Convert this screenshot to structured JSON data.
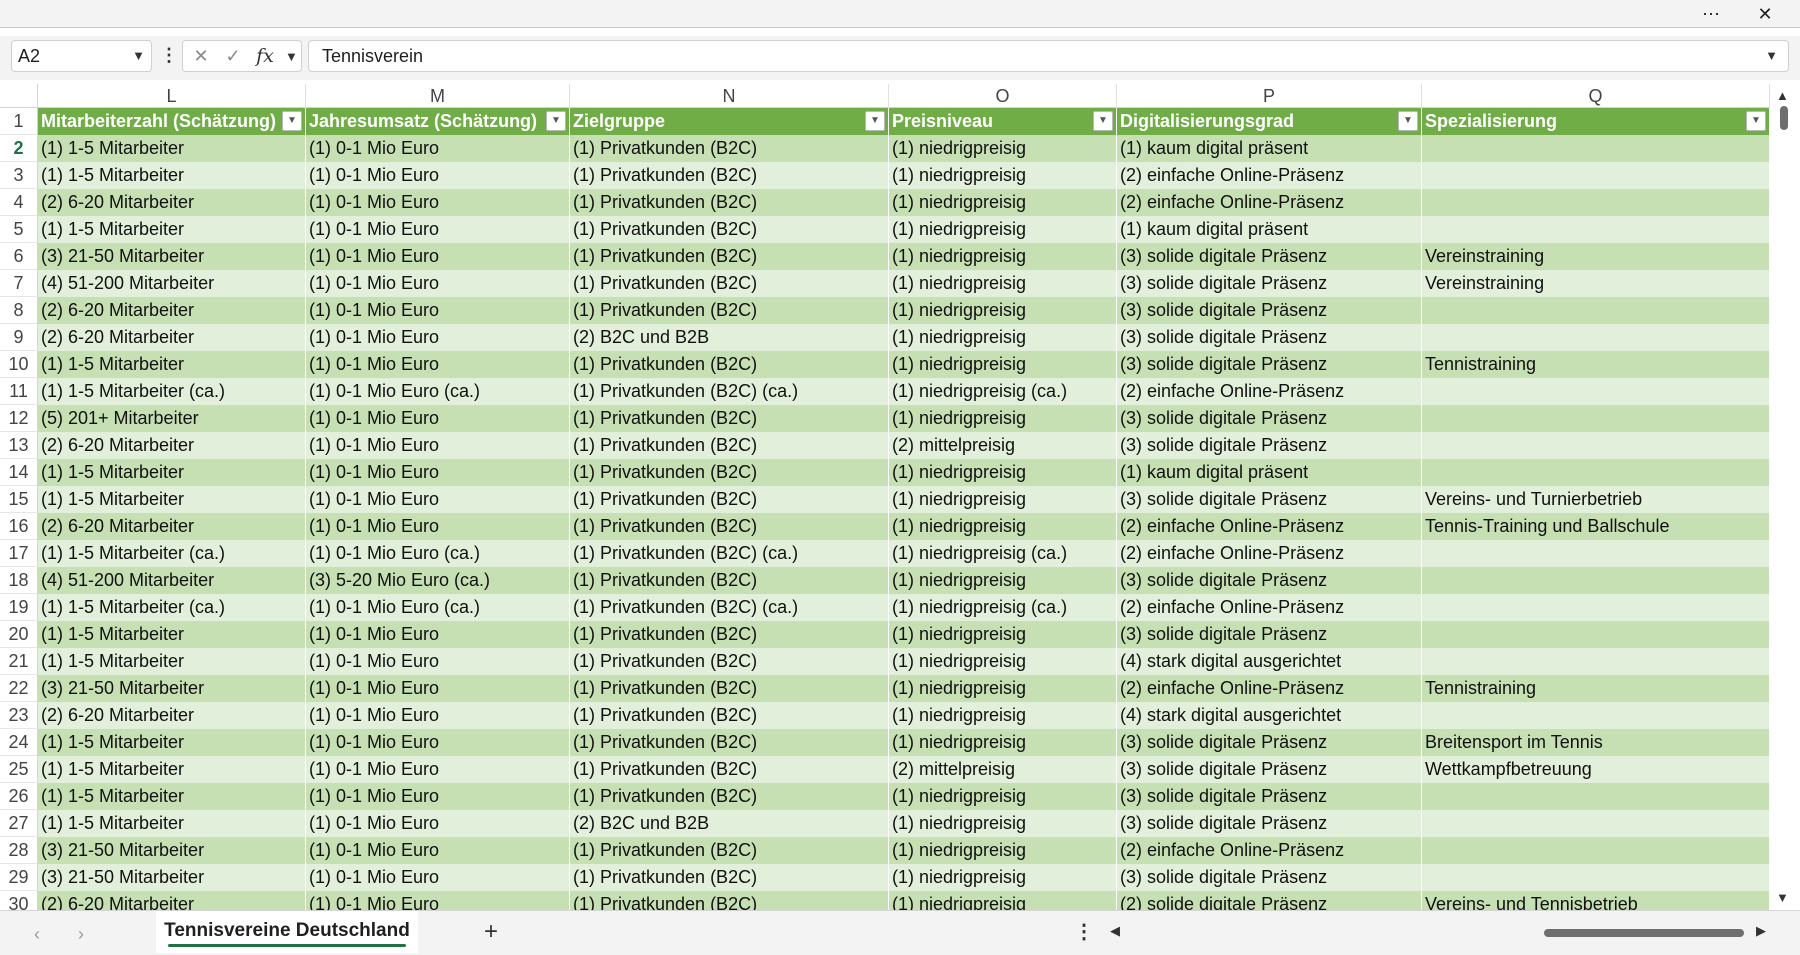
{
  "titlebar": {
    "more_icon": "⋯",
    "close_icon": "✕"
  },
  "formula_bar": {
    "name_box": "A2",
    "formula_value": "Tennisverein",
    "cancel_icon": "✕",
    "enter_icon": "✓",
    "fx_label": "fx"
  },
  "columns": [
    {
      "letter": "L",
      "header": "Mitarbeiterzahl (Schätzung)"
    },
    {
      "letter": "M",
      "header": "Jahresumsatz (Schätzung)"
    },
    {
      "letter": "N",
      "header": "Zielgruppe"
    },
    {
      "letter": "O",
      "header": "Preisniveau"
    },
    {
      "letter": "P",
      "header": "Digitalisierungsgrad"
    },
    {
      "letter": "Q",
      "header": "Spezialisierung"
    }
  ],
  "header_row_number": "1",
  "rows": [
    {
      "num": "2",
      "cells": [
        "(1) 1-5 Mitarbeiter",
        "(1) 0-1 Mio Euro",
        "(1) Privatkunden (B2C)",
        "(1) niedrigpreisig",
        "(1) kaum digital präsent",
        ""
      ]
    },
    {
      "num": "3",
      "cells": [
        "(1) 1-5 Mitarbeiter",
        "(1) 0-1 Mio Euro",
        "(1) Privatkunden (B2C)",
        "(1) niedrigpreisig",
        "(2) einfache Online-Präsenz",
        ""
      ]
    },
    {
      "num": "4",
      "cells": [
        "(2) 6-20 Mitarbeiter",
        "(1) 0-1 Mio Euro",
        "(1) Privatkunden (B2C)",
        "(1) niedrigpreisig",
        "(2) einfache Online-Präsenz",
        ""
      ]
    },
    {
      "num": "5",
      "cells": [
        "(1) 1-5 Mitarbeiter",
        "(1) 0-1 Mio Euro",
        "(1) Privatkunden (B2C)",
        "(1) niedrigpreisig",
        "(1) kaum digital präsent",
        ""
      ]
    },
    {
      "num": "6",
      "cells": [
        "(3) 21-50 Mitarbeiter",
        "(1) 0-1 Mio Euro",
        "(1) Privatkunden (B2C)",
        "(1) niedrigpreisig",
        "(3) solide digitale Präsenz",
        "Vereinstraining"
      ]
    },
    {
      "num": "7",
      "cells": [
        "(4) 51-200 Mitarbeiter",
        "(1) 0-1 Mio Euro",
        "(1) Privatkunden (B2C)",
        "(1) niedrigpreisig",
        "(3) solide digitale Präsenz",
        "Vereinstraining"
      ]
    },
    {
      "num": "8",
      "cells": [
        "(2) 6-20 Mitarbeiter",
        "(1) 0-1 Mio Euro",
        "(1) Privatkunden (B2C)",
        "(1) niedrigpreisig",
        "(3) solide digitale Präsenz",
        ""
      ]
    },
    {
      "num": "9",
      "cells": [
        "(2) 6-20 Mitarbeiter",
        "(1) 0-1 Mio Euro",
        "(2) B2C und B2B",
        "(1) niedrigpreisig",
        "(3) solide digitale Präsenz",
        ""
      ]
    },
    {
      "num": "10",
      "cells": [
        "(1) 1-5 Mitarbeiter",
        "(1) 0-1 Mio Euro",
        "(1) Privatkunden (B2C)",
        "(1) niedrigpreisig",
        "(3) solide digitale Präsenz",
        "Tennistraining"
      ]
    },
    {
      "num": "11",
      "cells": [
        "(1) 1-5 Mitarbeiter (ca.)",
        "(1) 0-1 Mio Euro (ca.)",
        "(1) Privatkunden (B2C) (ca.)",
        "(1) niedrigpreisig (ca.)",
        "(2) einfache Online-Präsenz",
        ""
      ]
    },
    {
      "num": "12",
      "cells": [
        "(5) 201+ Mitarbeiter",
        "(1) 0-1 Mio Euro",
        "(1) Privatkunden (B2C)",
        "(1) niedrigpreisig",
        "(3) solide digitale Präsenz",
        ""
      ]
    },
    {
      "num": "13",
      "cells": [
        "(2) 6-20 Mitarbeiter",
        "(1) 0-1 Mio Euro",
        "(1) Privatkunden (B2C)",
        "(2) mittelpreisig",
        "(3) solide digitale Präsenz",
        ""
      ]
    },
    {
      "num": "14",
      "cells": [
        "(1) 1-5 Mitarbeiter",
        "(1) 0-1 Mio Euro",
        "(1) Privatkunden (B2C)",
        "(1) niedrigpreisig",
        "(1) kaum digital präsent",
        ""
      ]
    },
    {
      "num": "15",
      "cells": [
        "(1) 1-5 Mitarbeiter",
        "(1) 0-1 Mio Euro",
        "(1) Privatkunden (B2C)",
        "(1) niedrigpreisig",
        "(3) solide digitale Präsenz",
        "Vereins- und Turnierbetrieb"
      ]
    },
    {
      "num": "16",
      "cells": [
        "(2) 6-20 Mitarbeiter",
        "(1) 0-1 Mio Euro",
        "(1) Privatkunden (B2C)",
        "(1) niedrigpreisig",
        "(2) einfache Online-Präsenz",
        "Tennis-Training und Ballschule"
      ]
    },
    {
      "num": "17",
      "cells": [
        "(1) 1-5 Mitarbeiter (ca.)",
        "(1) 0-1 Mio Euro (ca.)",
        "(1) Privatkunden (B2C) (ca.)",
        "(1) niedrigpreisig (ca.)",
        "(2) einfache Online-Präsenz",
        ""
      ]
    },
    {
      "num": "18",
      "cells": [
        "(4) 51-200 Mitarbeiter",
        "(3) 5-20 Mio Euro (ca.)",
        "(1) Privatkunden (B2C)",
        "(1) niedrigpreisig",
        "(3) solide digitale Präsenz",
        ""
      ]
    },
    {
      "num": "19",
      "cells": [
        "(1) 1-5 Mitarbeiter (ca.)",
        "(1) 0-1 Mio Euro (ca.)",
        "(1) Privatkunden (B2C) (ca.)",
        "(1) niedrigpreisig (ca.)",
        "(2) einfache Online-Präsenz",
        ""
      ]
    },
    {
      "num": "20",
      "cells": [
        "(1) 1-5 Mitarbeiter",
        "(1) 0-1 Mio Euro",
        "(1) Privatkunden (B2C)",
        "(1) niedrigpreisig",
        "(3) solide digitale Präsenz",
        ""
      ]
    },
    {
      "num": "21",
      "cells": [
        "(1) 1-5 Mitarbeiter",
        "(1) 0-1 Mio Euro",
        "(1) Privatkunden (B2C)",
        "(1) niedrigpreisig",
        "(4) stark digital ausgerichtet",
        ""
      ]
    },
    {
      "num": "22",
      "cells": [
        "(3) 21-50 Mitarbeiter",
        "(1) 0-1 Mio Euro",
        "(1) Privatkunden (B2C)",
        "(1) niedrigpreisig",
        "(2) einfache Online-Präsenz",
        "Tennistraining"
      ]
    },
    {
      "num": "23",
      "cells": [
        "(2) 6-20 Mitarbeiter",
        "(1) 0-1 Mio Euro",
        "(1) Privatkunden (B2C)",
        "(1) niedrigpreisig",
        "(4) stark digital ausgerichtet",
        ""
      ]
    },
    {
      "num": "24",
      "cells": [
        "(1) 1-5 Mitarbeiter",
        "(1) 0-1 Mio Euro",
        "(1) Privatkunden (B2C)",
        "(1) niedrigpreisig",
        "(3) solide digitale Präsenz",
        "Breitensport im Tennis"
      ]
    },
    {
      "num": "25",
      "cells": [
        "(1) 1-5 Mitarbeiter",
        "(1) 0-1 Mio Euro",
        "(1) Privatkunden (B2C)",
        "(2) mittelpreisig",
        "(3) solide digitale Präsenz",
        "Wettkampfbetreuung"
      ]
    },
    {
      "num": "26",
      "cells": [
        "(1) 1-5 Mitarbeiter",
        "(1) 0-1 Mio Euro",
        "(1) Privatkunden (B2C)",
        "(1) niedrigpreisig",
        "(3) solide digitale Präsenz",
        ""
      ]
    },
    {
      "num": "27",
      "cells": [
        "(1) 1-5 Mitarbeiter",
        "(1) 0-1 Mio Euro",
        "(2) B2C und B2B",
        "(1) niedrigpreisig",
        "(3) solide digitale Präsenz",
        ""
      ]
    },
    {
      "num": "28",
      "cells": [
        "(3) 21-50 Mitarbeiter",
        "(1) 0-1 Mio Euro",
        "(1) Privatkunden (B2C)",
        "(1) niedrigpreisig",
        "(2) einfache Online-Präsenz",
        ""
      ]
    },
    {
      "num": "29",
      "cells": [
        "(3) 21-50 Mitarbeiter",
        "(1) 0-1 Mio Euro",
        "(1) Privatkunden (B2C)",
        "(1) niedrigpreisig",
        "(3) solide digitale Präsenz",
        ""
      ]
    },
    {
      "num": "30",
      "cells": [
        "(2) 6-20 Mitarbeiter",
        "(1) 0-1 Mio Euro",
        "(1) Privatkunden (B2C)",
        "(1) niedrigpreisig",
        "(2) solide digitale Präsenz",
        "Vereins- und Tennisbetrieb"
      ]
    }
  ],
  "colors": {
    "header_green": "#70ad47",
    "band_dark": "#c6e0b4",
    "band_light": "#e2efda",
    "accent": "#217346"
  },
  "sheet_tabs": [
    {
      "label": "Tennisvereine Deutschland",
      "active": true
    }
  ],
  "bottom_bar": {
    "prev_icon": "‹",
    "next_icon": "›",
    "add_icon": "+",
    "more_icon": "⋮"
  }
}
